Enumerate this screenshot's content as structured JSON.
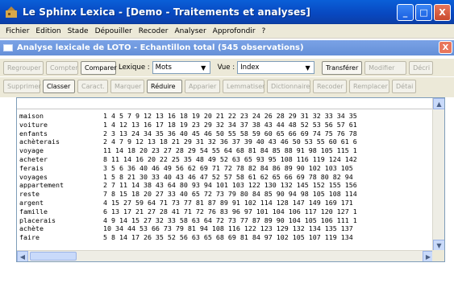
{
  "window": {
    "title": "Le Sphinx Lexica - [Demo - Traitements et analyses]",
    "buttons": {
      "minimize": "_",
      "maximize": "□",
      "close": "X"
    }
  },
  "menu": [
    "Fichier",
    "Edition",
    "Stade",
    "Dépouiller",
    "Recoder",
    "Analyser",
    "Approfondir",
    "?"
  ],
  "child": {
    "title": "Analyse lexicale de LOTO - Echantillon total (545 observations)",
    "close": "X"
  },
  "toolbar1": {
    "regrouper": "Regrouper",
    "compter": "Compter",
    "comparer": "Comparer",
    "lexique_label": "Lexique :",
    "lexique_value": "Mots",
    "vue_label": "Vue :",
    "vue_value": "Index",
    "transferer": "Transférer",
    "modifier": "Modifier",
    "decrire": "Décri"
  },
  "toolbar2": {
    "supprimer": "Supprimer",
    "classer": "Classer",
    "caract": "Caract.",
    "marquer": "Marquer",
    "reduire": "Réduire",
    "apparier": "Apparier",
    "lemmatiser": "Lemmatiser",
    "dictionnaire": "Dictionnaire",
    "recoder": "Recoder",
    "remplacer": "Remplacer",
    "detail": "Détai"
  },
  "scroll": {
    "up": "▲",
    "down": "▼",
    "left": "◀",
    "right": "▶"
  },
  "index_rows": [
    {
      "word": "maison",
      "refs": "1 4 5 7 9 12 13 16 18 19 20 21 22 23 24 26 28 29 31 32 33 34 35"
    },
    {
      "word": "voiture",
      "refs": "1 4 12 13 16 17 18 19 23 29 32 34 37 38 43 44 48 52 53 56 57 61"
    },
    {
      "word": "enfants",
      "refs": "2 3 13 24 34 35 36 40 45 46 50 55 58 59 60 65 66 69 74 75 76 78"
    },
    {
      "word": "achèterais",
      "refs": "2 4 7 9 12 13 18 21 29 31 32 36 37 39 40 43 46 50 53 55 60 61 6"
    },
    {
      "word": "voyage",
      "refs": "11 14 18 20 23 27 28 29 54 55 64 68 81 84 85 88 91 98 105 115 1"
    },
    {
      "word": "acheter",
      "refs": "8 11 14 16 20 22 25 35 48 49 52 63 65 93 95 108 116 119 124 142"
    },
    {
      "word": "ferais",
      "refs": "3 5 6 36 40 46 49 56 62 69 71 72 78 82 84 86 89 90 102 103 105"
    },
    {
      "word": "voyages",
      "refs": "1 5 8 21 30 33 40 43 46 47 52 57 58 61 62 65 66 69 78 80 82 94"
    },
    {
      "word": "appartement",
      "refs": "2 7 11 14 38 43 64 80 93 94 101 103 122 130 132 145 152 155 156"
    },
    {
      "word": "reste",
      "refs": "7 8 15 18 20 27 33 40 65 72 73 79 80 84 85 90 94 98 105 108 114"
    },
    {
      "word": "argent",
      "refs": "4 15 27 59 64 71 73 77 81 87 89 91 102 114 128 147 149 169 171"
    },
    {
      "word": "famille",
      "refs": "6 13 17 21 27 28 41 71 72 76 83 96 97 101 104 106 117 120 127 1"
    },
    {
      "word": "placerais",
      "refs": "4 9 14 15 27 32 33 58 63 64 72 73 77 87 89 90 104 105 106 111 1"
    },
    {
      "word": "achète",
      "refs": "10 34 44 53 66 73 79 81 94 108 116 122 123 129 132 134 135 137"
    },
    {
      "word": "faire",
      "refs": "5 8 14 17 26 35 52 56 63 65 68 69 81 84 97 102 105 107 119 134"
    }
  ]
}
